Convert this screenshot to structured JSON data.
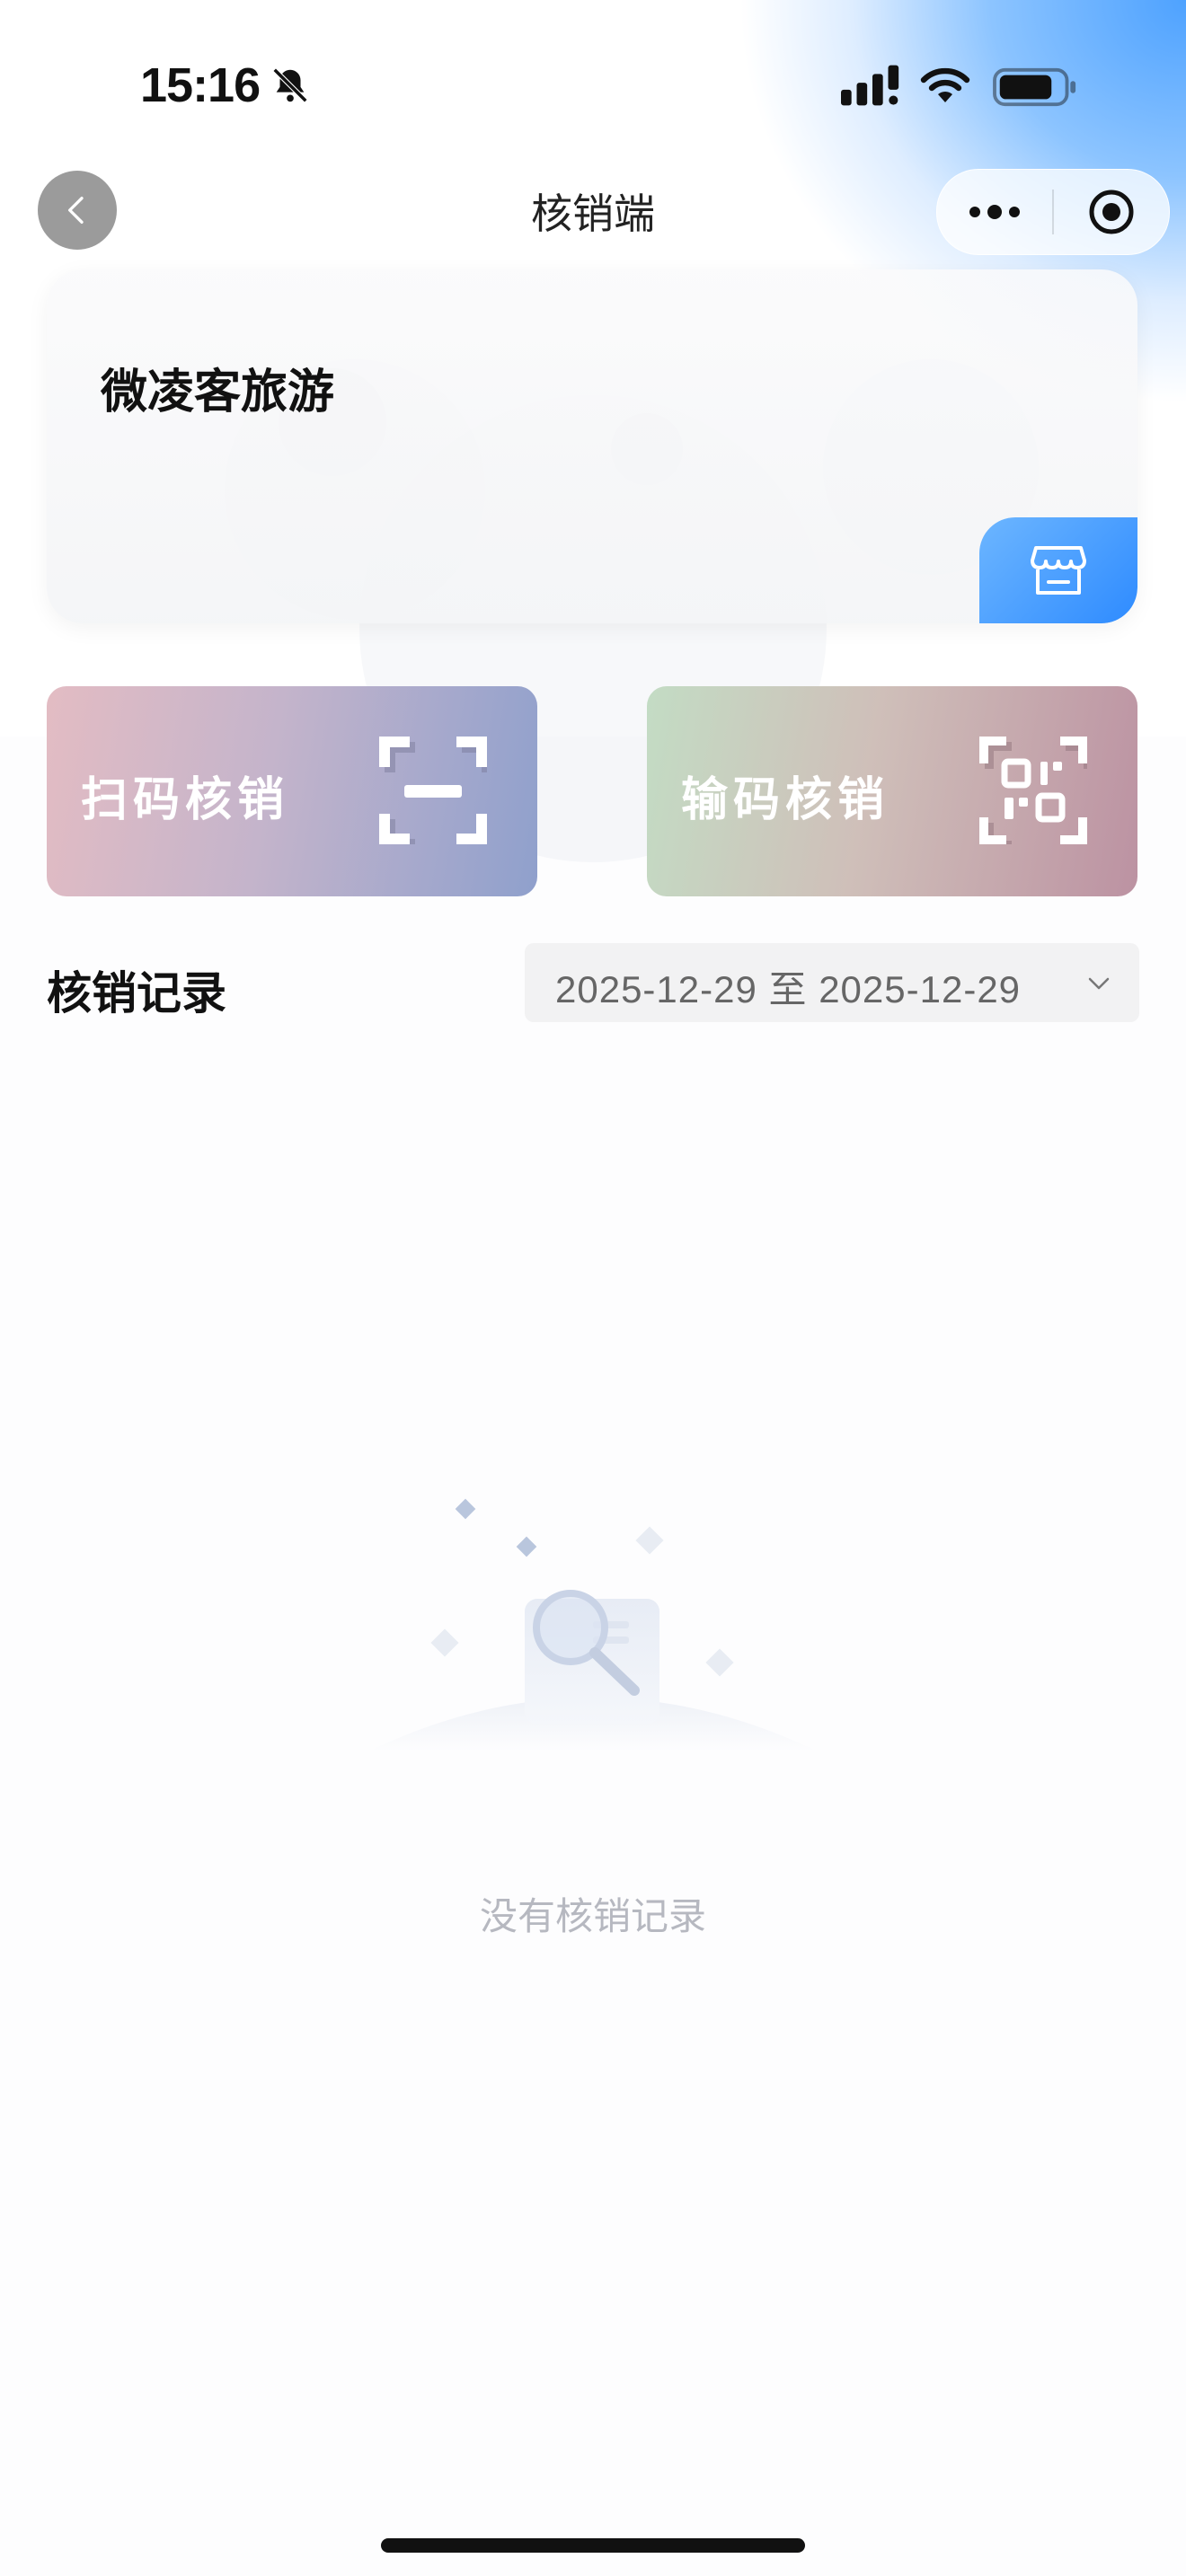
{
  "status_bar": {
    "time": "15:16"
  },
  "nav": {
    "title": "核销端"
  },
  "store": {
    "name": "微凌客旅游"
  },
  "actions": {
    "scan_label": "扫码核销",
    "input_label": "输码核销"
  },
  "records": {
    "title": "核销记录",
    "date_start": "2025-12-29",
    "date_separator": "至",
    "date_end": "2025-12-29",
    "empty_text": "没有核销记录"
  },
  "colors": {
    "accent": "#2e8bff",
    "empty_text": "#b6b8c0"
  }
}
